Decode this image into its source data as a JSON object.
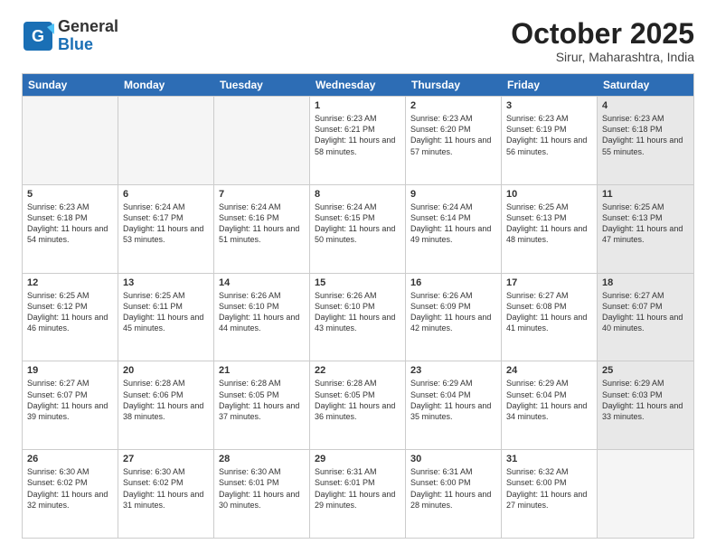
{
  "header": {
    "logo_general": "General",
    "logo_blue": "Blue",
    "month_title": "October 2025",
    "location": "Sirur, Maharashtra, India"
  },
  "weekdays": [
    "Sunday",
    "Monday",
    "Tuesday",
    "Wednesday",
    "Thursday",
    "Friday",
    "Saturday"
  ],
  "rows": [
    [
      {
        "day": "",
        "empty": true
      },
      {
        "day": "",
        "empty": true
      },
      {
        "day": "",
        "empty": true
      },
      {
        "day": "1",
        "sunrise": "Sunrise: 6:23 AM",
        "sunset": "Sunset: 6:21 PM",
        "daylight": "Daylight: 11 hours and 58 minutes."
      },
      {
        "day": "2",
        "sunrise": "Sunrise: 6:23 AM",
        "sunset": "Sunset: 6:20 PM",
        "daylight": "Daylight: 11 hours and 57 minutes."
      },
      {
        "day": "3",
        "sunrise": "Sunrise: 6:23 AM",
        "sunset": "Sunset: 6:19 PM",
        "daylight": "Daylight: 11 hours and 56 minutes."
      },
      {
        "day": "4",
        "sunrise": "Sunrise: 6:23 AM",
        "sunset": "Sunset: 6:18 PM",
        "daylight": "Daylight: 11 hours and 55 minutes.",
        "shaded": true
      }
    ],
    [
      {
        "day": "5",
        "sunrise": "Sunrise: 6:23 AM",
        "sunset": "Sunset: 6:18 PM",
        "daylight": "Daylight: 11 hours and 54 minutes."
      },
      {
        "day": "6",
        "sunrise": "Sunrise: 6:24 AM",
        "sunset": "Sunset: 6:17 PM",
        "daylight": "Daylight: 11 hours and 53 minutes."
      },
      {
        "day": "7",
        "sunrise": "Sunrise: 6:24 AM",
        "sunset": "Sunset: 6:16 PM",
        "daylight": "Daylight: 11 hours and 51 minutes."
      },
      {
        "day": "8",
        "sunrise": "Sunrise: 6:24 AM",
        "sunset": "Sunset: 6:15 PM",
        "daylight": "Daylight: 11 hours and 50 minutes."
      },
      {
        "day": "9",
        "sunrise": "Sunrise: 6:24 AM",
        "sunset": "Sunset: 6:14 PM",
        "daylight": "Daylight: 11 hours and 49 minutes."
      },
      {
        "day": "10",
        "sunrise": "Sunrise: 6:25 AM",
        "sunset": "Sunset: 6:13 PM",
        "daylight": "Daylight: 11 hours and 48 minutes."
      },
      {
        "day": "11",
        "sunrise": "Sunrise: 6:25 AM",
        "sunset": "Sunset: 6:13 PM",
        "daylight": "Daylight: 11 hours and 47 minutes.",
        "shaded": true
      }
    ],
    [
      {
        "day": "12",
        "sunrise": "Sunrise: 6:25 AM",
        "sunset": "Sunset: 6:12 PM",
        "daylight": "Daylight: 11 hours and 46 minutes."
      },
      {
        "day": "13",
        "sunrise": "Sunrise: 6:25 AM",
        "sunset": "Sunset: 6:11 PM",
        "daylight": "Daylight: 11 hours and 45 minutes."
      },
      {
        "day": "14",
        "sunrise": "Sunrise: 6:26 AM",
        "sunset": "Sunset: 6:10 PM",
        "daylight": "Daylight: 11 hours and 44 minutes."
      },
      {
        "day": "15",
        "sunrise": "Sunrise: 6:26 AM",
        "sunset": "Sunset: 6:10 PM",
        "daylight": "Daylight: 11 hours and 43 minutes."
      },
      {
        "day": "16",
        "sunrise": "Sunrise: 6:26 AM",
        "sunset": "Sunset: 6:09 PM",
        "daylight": "Daylight: 11 hours and 42 minutes."
      },
      {
        "day": "17",
        "sunrise": "Sunrise: 6:27 AM",
        "sunset": "Sunset: 6:08 PM",
        "daylight": "Daylight: 11 hours and 41 minutes."
      },
      {
        "day": "18",
        "sunrise": "Sunrise: 6:27 AM",
        "sunset": "Sunset: 6:07 PM",
        "daylight": "Daylight: 11 hours and 40 minutes.",
        "shaded": true
      }
    ],
    [
      {
        "day": "19",
        "sunrise": "Sunrise: 6:27 AM",
        "sunset": "Sunset: 6:07 PM",
        "daylight": "Daylight: 11 hours and 39 minutes."
      },
      {
        "day": "20",
        "sunrise": "Sunrise: 6:28 AM",
        "sunset": "Sunset: 6:06 PM",
        "daylight": "Daylight: 11 hours and 38 minutes."
      },
      {
        "day": "21",
        "sunrise": "Sunrise: 6:28 AM",
        "sunset": "Sunset: 6:05 PM",
        "daylight": "Daylight: 11 hours and 37 minutes."
      },
      {
        "day": "22",
        "sunrise": "Sunrise: 6:28 AM",
        "sunset": "Sunset: 6:05 PM",
        "daylight": "Daylight: 11 hours and 36 minutes."
      },
      {
        "day": "23",
        "sunrise": "Sunrise: 6:29 AM",
        "sunset": "Sunset: 6:04 PM",
        "daylight": "Daylight: 11 hours and 35 minutes."
      },
      {
        "day": "24",
        "sunrise": "Sunrise: 6:29 AM",
        "sunset": "Sunset: 6:04 PM",
        "daylight": "Daylight: 11 hours and 34 minutes."
      },
      {
        "day": "25",
        "sunrise": "Sunrise: 6:29 AM",
        "sunset": "Sunset: 6:03 PM",
        "daylight": "Daylight: 11 hours and 33 minutes.",
        "shaded": true
      }
    ],
    [
      {
        "day": "26",
        "sunrise": "Sunrise: 6:30 AM",
        "sunset": "Sunset: 6:02 PM",
        "daylight": "Daylight: 11 hours and 32 minutes."
      },
      {
        "day": "27",
        "sunrise": "Sunrise: 6:30 AM",
        "sunset": "Sunset: 6:02 PM",
        "daylight": "Daylight: 11 hours and 31 minutes."
      },
      {
        "day": "28",
        "sunrise": "Sunrise: 6:30 AM",
        "sunset": "Sunset: 6:01 PM",
        "daylight": "Daylight: 11 hours and 30 minutes."
      },
      {
        "day": "29",
        "sunrise": "Sunrise: 6:31 AM",
        "sunset": "Sunset: 6:01 PM",
        "daylight": "Daylight: 11 hours and 29 minutes."
      },
      {
        "day": "30",
        "sunrise": "Sunrise: 6:31 AM",
        "sunset": "Sunset: 6:00 PM",
        "daylight": "Daylight: 11 hours and 28 minutes."
      },
      {
        "day": "31",
        "sunrise": "Sunrise: 6:32 AM",
        "sunset": "Sunset: 6:00 PM",
        "daylight": "Daylight: 11 hours and 27 minutes."
      },
      {
        "day": "",
        "empty": true,
        "shaded": true
      }
    ]
  ]
}
